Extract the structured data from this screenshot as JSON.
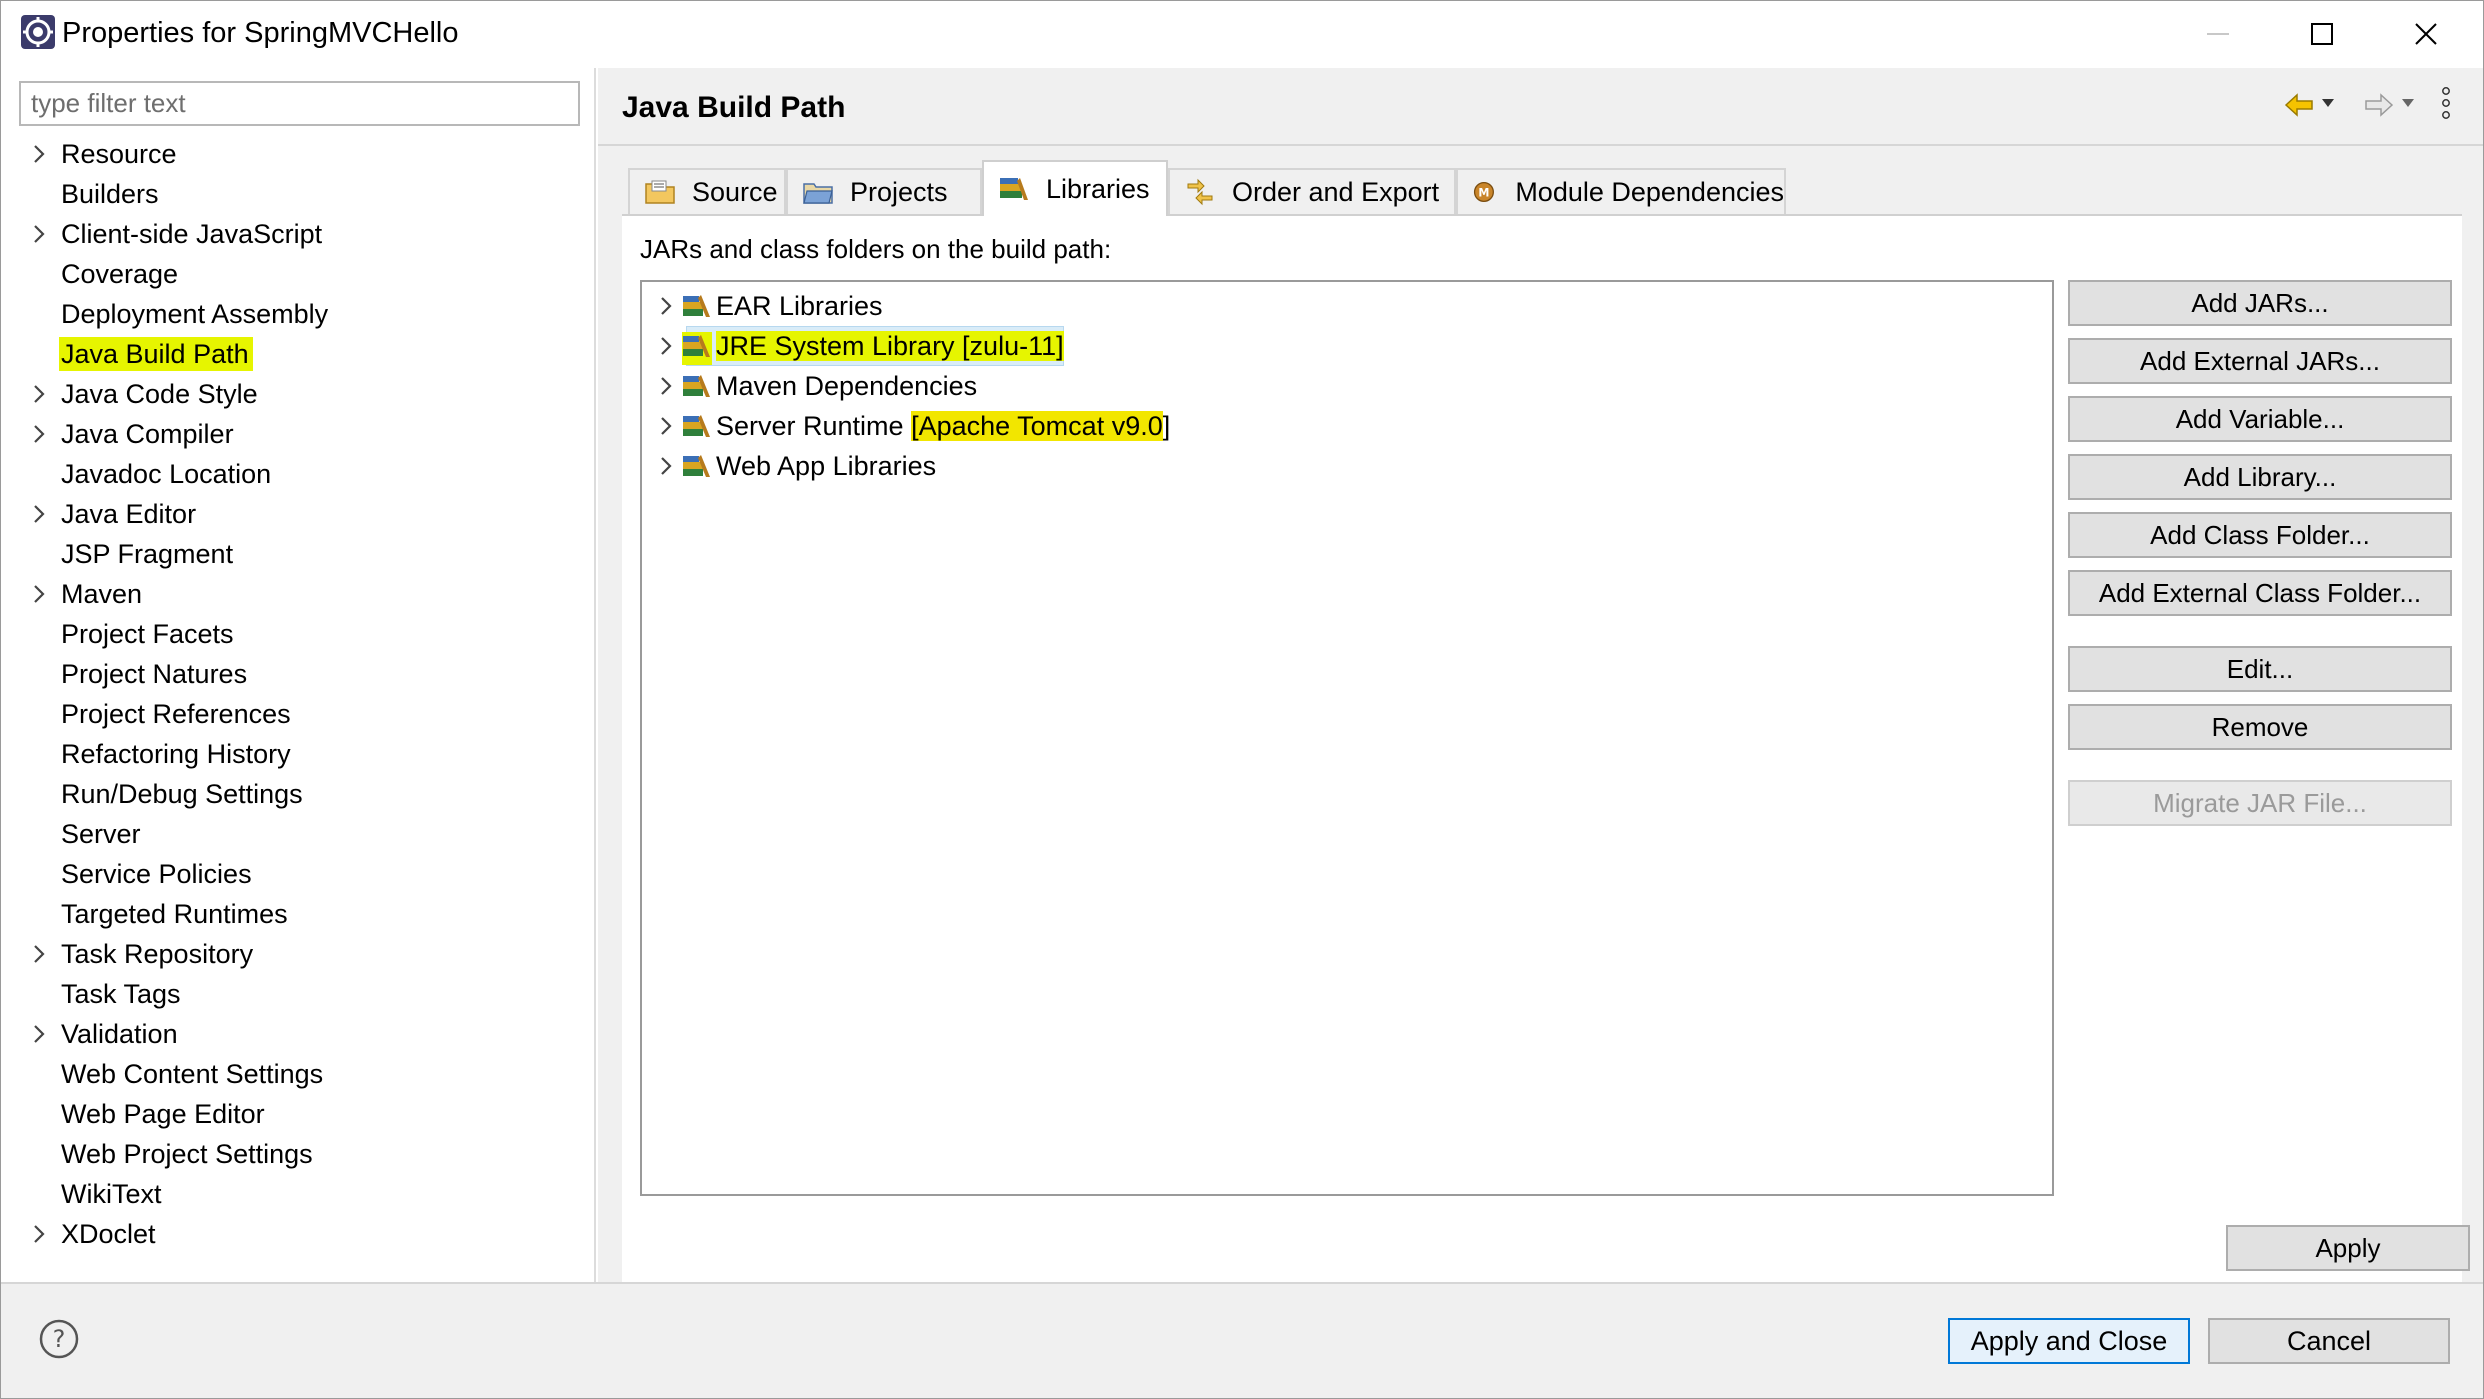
{
  "window": {
    "title": "Properties for SpringMVCHello",
    "controls": {
      "minimize": "minimize-icon",
      "maximize": "maximize-icon",
      "close": "close-icon"
    }
  },
  "filter": {
    "placeholder": "type filter text",
    "value": ""
  },
  "sidebar": {
    "items": [
      {
        "label": "Resource",
        "expandable": true
      },
      {
        "label": "Builders",
        "expandable": false
      },
      {
        "label": "Client-side JavaScript",
        "expandable": true
      },
      {
        "label": "Coverage",
        "expandable": false
      },
      {
        "label": "Deployment Assembly",
        "expandable": false
      },
      {
        "label": "Java Build Path",
        "expandable": false,
        "selected": true
      },
      {
        "label": "Java Code Style",
        "expandable": true
      },
      {
        "label": "Java Compiler",
        "expandable": true
      },
      {
        "label": "Javadoc Location",
        "expandable": false
      },
      {
        "label": "Java Editor",
        "expandable": true
      },
      {
        "label": "JSP Fragment",
        "expandable": false
      },
      {
        "label": "Maven",
        "expandable": true
      },
      {
        "label": "Project Facets",
        "expandable": false
      },
      {
        "label": "Project Natures",
        "expandable": false
      },
      {
        "label": "Project References",
        "expandable": false
      },
      {
        "label": "Refactoring History",
        "expandable": false
      },
      {
        "label": "Run/Debug Settings",
        "expandable": false
      },
      {
        "label": "Server",
        "expandable": false
      },
      {
        "label": "Service Policies",
        "expandable": false
      },
      {
        "label": "Targeted Runtimes",
        "expandable": false
      },
      {
        "label": "Task Repository",
        "expandable": true
      },
      {
        "label": "Task Tags",
        "expandable": false
      },
      {
        "label": "Validation",
        "expandable": true
      },
      {
        "label": "Web Content Settings",
        "expandable": false
      },
      {
        "label": "Web Page Editor",
        "expandable": false
      },
      {
        "label": "Web Project Settings",
        "expandable": false
      },
      {
        "label": "WikiText",
        "expandable": false
      },
      {
        "label": "XDoclet",
        "expandable": true
      }
    ]
  },
  "page": {
    "title": "Java Build Path",
    "tabs": [
      {
        "label": "Source",
        "icon": "source-folder-icon"
      },
      {
        "label": "Projects",
        "icon": "projects-folder-icon"
      },
      {
        "label": "Libraries",
        "icon": "libraries-icon",
        "active": true
      },
      {
        "label": "Order and Export",
        "icon": "order-export-icon"
      },
      {
        "label": "Module Dependencies",
        "icon": "module-icon"
      }
    ],
    "section_label": "JARs and class folders on the build path:",
    "libraries": [
      {
        "label": "EAR Libraries"
      },
      {
        "label": "JRE System Library [zulu-11]",
        "highlighted": true,
        "selected": true
      },
      {
        "label": "Maven Dependencies"
      },
      {
        "label": "Server Runtime ",
        "label_highlight": "[Apache Tomcat v9.0",
        "label_suffix": "]"
      },
      {
        "label": "Web App Libraries"
      }
    ],
    "buttons": {
      "add_jars": "Add JARs...",
      "add_external_jars": "Add External JARs...",
      "add_variable": "Add Variable...",
      "add_library": "Add Library...",
      "add_class_folder": "Add Class Folder...",
      "add_external_class_folder": "Add External Class Folder...",
      "edit": "Edit...",
      "remove": "Remove",
      "migrate_jar": "Migrate JAR File..."
    },
    "apply": "Apply"
  },
  "footer": {
    "help_icon": "help-icon",
    "apply_and_close": "Apply and Close",
    "cancel": "Cancel"
  },
  "colors": {
    "highlight": "#e6f500",
    "highlight_alt": "#f2e600",
    "default_button_border": "#0078d7"
  }
}
